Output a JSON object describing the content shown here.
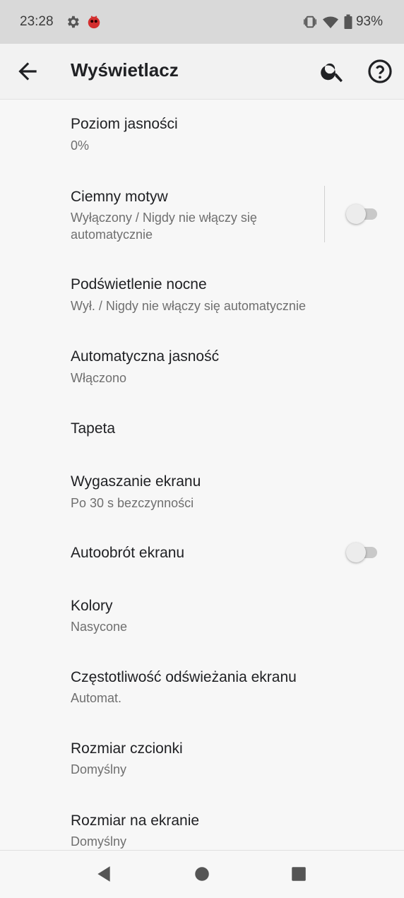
{
  "status_bar": {
    "time": "23:28",
    "battery": "93%",
    "icons": [
      "gear-icon",
      "app-badge-icon",
      "vibrate-icon",
      "wifi-icon",
      "battery-icon"
    ]
  },
  "app_bar": {
    "title": "Wyświetlacz",
    "back_icon": "arrow-back-icon",
    "search_icon": "search-icon",
    "help_icon": "help-icon"
  },
  "settings": [
    {
      "title": "Poziom jasności",
      "summary": "0%"
    },
    {
      "title": "Ciemny motyw",
      "summary": "Wyłączony / Nigdy nie włączy się automatycznie",
      "toggle": false
    },
    {
      "title": "Podświetlenie nocne",
      "summary": "Wył. / Nigdy nie włączy się automatycznie"
    },
    {
      "title": "Automatyczna jasność",
      "summary": "Włączono"
    },
    {
      "title": "Tapeta"
    },
    {
      "title": "Wygaszanie ekranu",
      "summary": "Po 30 s bezczynności"
    },
    {
      "title": "Autoobrót ekranu",
      "toggle": false
    },
    {
      "title": "Kolory",
      "summary": "Nasycone"
    },
    {
      "title": "Częstotliwość odświeżania ekranu",
      "summary": "Automat."
    },
    {
      "title": "Rozmiar czcionki",
      "summary": "Domyślny"
    },
    {
      "title": "Rozmiar na ekranie",
      "summary": "Domyślny"
    }
  ],
  "nav_bar": {
    "icons": [
      "back-triangle-icon",
      "home-circle-icon",
      "recents-square-icon"
    ]
  },
  "colors": {
    "status_bar_bg": "#d9d9d9",
    "app_bar_bg": "#f2f2f2",
    "page_bg": "#f7f7f7",
    "title_text": "#202124",
    "summary_text": "#6f6f6f"
  }
}
